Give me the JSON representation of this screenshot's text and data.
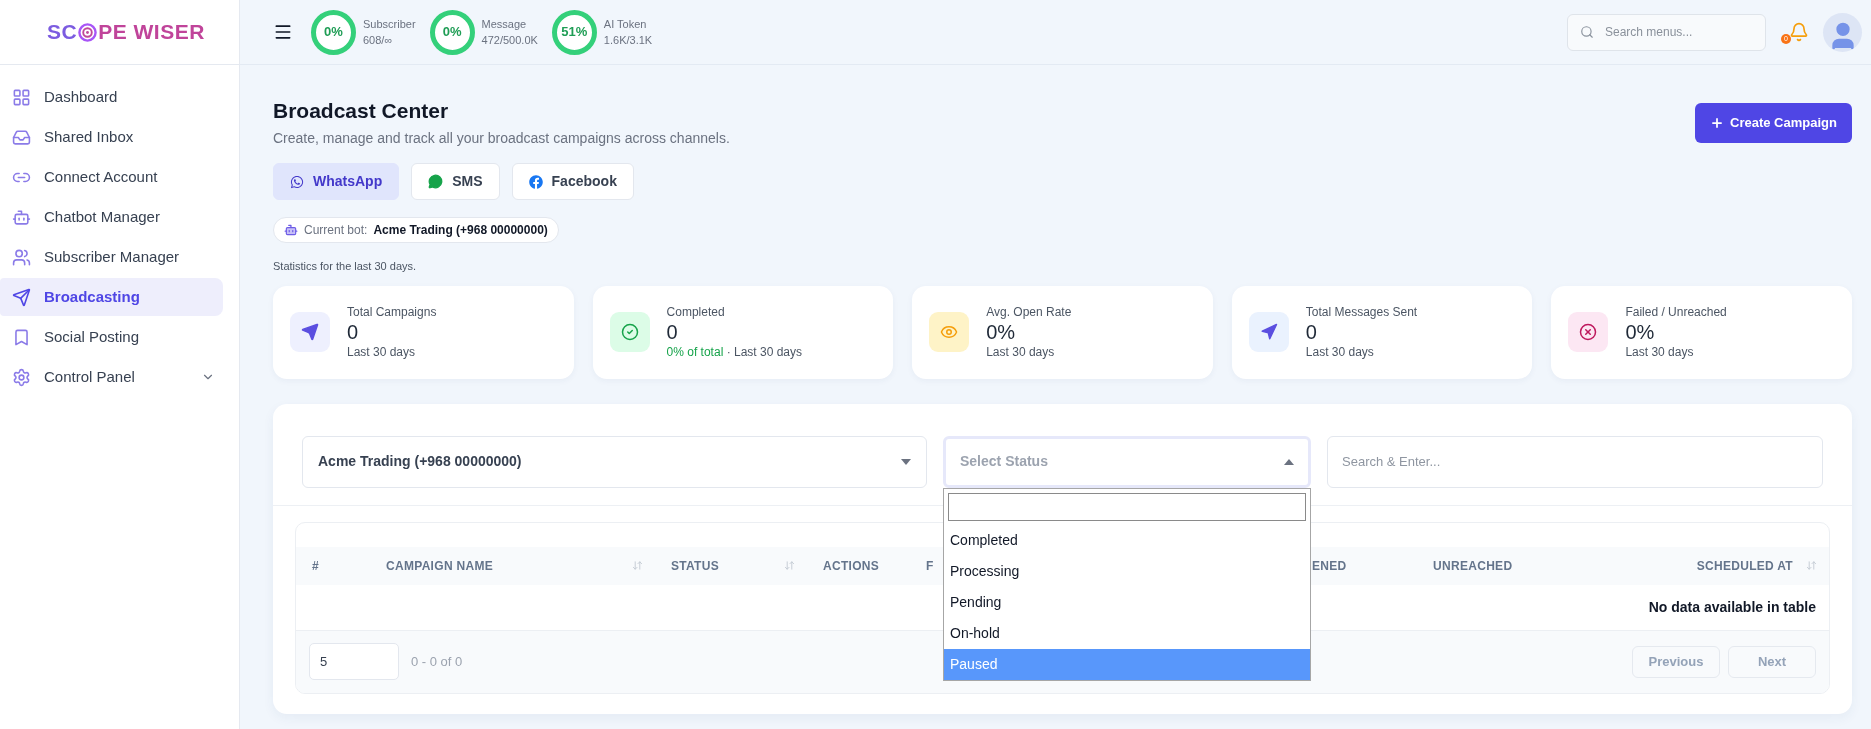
{
  "logo": {
    "before": "SC",
    "after": "PE WISER"
  },
  "sidebar": {
    "items": [
      {
        "label": "Dashboard",
        "selected": false
      },
      {
        "label": "Shared Inbox",
        "selected": false
      },
      {
        "label": "Connect Account",
        "selected": false
      },
      {
        "label": "Chatbot Manager",
        "selected": false
      },
      {
        "label": "Subscriber Manager",
        "selected": false
      },
      {
        "label": "Broadcasting",
        "selected": true
      },
      {
        "label": "Social Posting",
        "selected": false
      },
      {
        "label": "Control Panel",
        "selected": false,
        "expandable": true
      }
    ]
  },
  "usage": [
    {
      "ring": "0%",
      "label": "Subscriber",
      "value": "608/∞"
    },
    {
      "ring": "0%",
      "label": "Message",
      "value": "472/500.0K"
    },
    {
      "ring": "51%",
      "label": "AI Token",
      "value": "1.6K/3.1K"
    }
  ],
  "search": {
    "placeholder": "Search menus..."
  },
  "notifications": {
    "badge": "0"
  },
  "page": {
    "title": "Broadcast Center",
    "subtitle": "Create, manage and track all your broadcast campaigns across channels.",
    "create_button": "Create Campaign"
  },
  "channels": [
    {
      "label": "WhatsApp",
      "selected": true
    },
    {
      "label": "SMS",
      "selected": false
    },
    {
      "label": "Facebook",
      "selected": false
    }
  ],
  "current_bot": {
    "label": "Current bot:",
    "value": "Acme Trading (+968 00000000)"
  },
  "stats_note": "Statistics for the last 30 days.",
  "stats": [
    {
      "kind": "send",
      "title": "Total Campaigns",
      "value": "0",
      "note": "Last 30 days"
    },
    {
      "kind": "check",
      "title": "Completed",
      "value": "0",
      "highlight": "0% of total",
      "note": " · Last 30 days"
    },
    {
      "kind": "eye",
      "title": "Avg. Open Rate",
      "value": "0%",
      "note": "Last 30 days"
    },
    {
      "kind": "navigation",
      "title": "Total Messages Sent",
      "value": "0",
      "note": "Last 30 days"
    },
    {
      "kind": "failed",
      "title": "Failed / Unreached",
      "value": "0%",
      "note": "Last 30 days"
    }
  ],
  "filters": {
    "bot_select": "Acme Trading (+968 00000000)",
    "status_select": {
      "placeholder": "Select Status",
      "expanded": true
    },
    "search": {
      "placeholder": "Search & Enter..."
    }
  },
  "status_options": [
    {
      "label": "Completed",
      "selected": false
    },
    {
      "label": "Processing",
      "selected": false
    },
    {
      "label": "Pending",
      "selected": false
    },
    {
      "label": "On-hold",
      "selected": false
    },
    {
      "label": "Paused",
      "selected": true
    }
  ],
  "table": {
    "columns": [
      {
        "label": "#",
        "sortable": false
      },
      {
        "label": "CAMPAIGN NAME",
        "sortable": true
      },
      {
        "label": "STATUS",
        "sortable": true
      },
      {
        "label": "ACTIONS",
        "sortable": false
      },
      {
        "label": "F"
      },
      {
        "label": "ENED"
      },
      {
        "label": "UNREACHED",
        "sortable": false
      },
      {
        "label": "SCHEDULED AT",
        "sortable": true
      }
    ],
    "empty": "No data available in table",
    "page_size": "5",
    "range": "0 - 0 of 0",
    "previous": "Previous",
    "next": "Next"
  }
}
